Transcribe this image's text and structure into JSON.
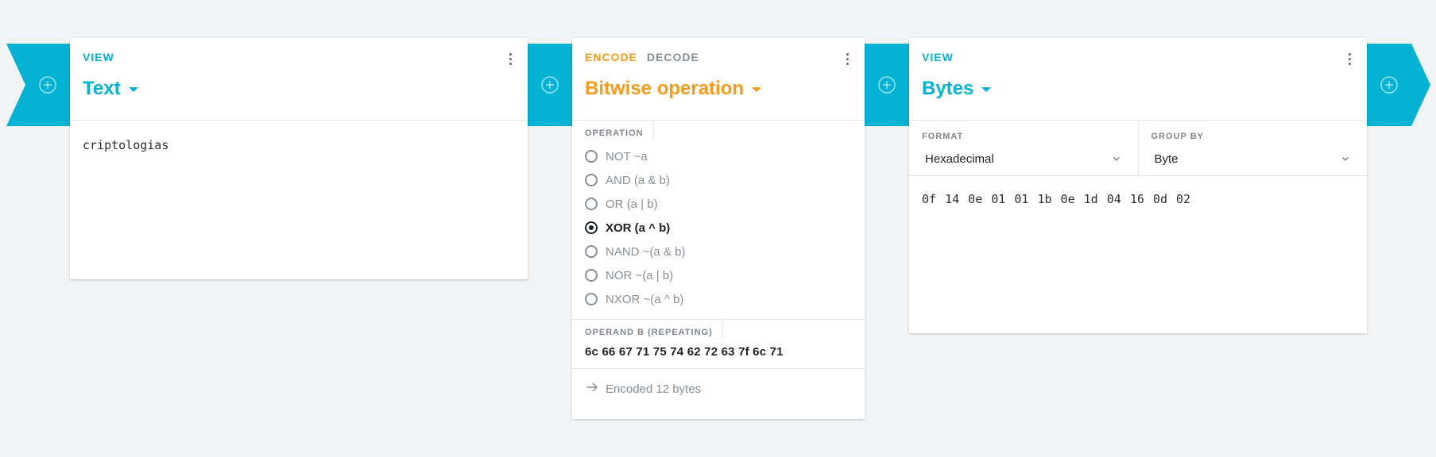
{
  "colors": {
    "accent_cyan": "#04b3d4",
    "accent_orange": "#f79b1a",
    "background": "#f2f3f5"
  },
  "connectors": [
    {
      "icon": "plus-circle-icon"
    },
    {
      "icon": "plus-circle-icon"
    },
    {
      "icon": "plus-circle-icon"
    },
    {
      "icon": "plus-circle-icon"
    }
  ],
  "text_card": {
    "tab_view": "VIEW",
    "title": "Text",
    "content": "criptologias"
  },
  "bitwise_card": {
    "tab_encode": "ENCODE",
    "tab_decode": "DECODE",
    "title": "Bitwise operation",
    "operation_label": "OPERATION",
    "operations": [
      {
        "label": "NOT ~a",
        "selected": false
      },
      {
        "label": "AND (a & b)",
        "selected": false
      },
      {
        "label": "OR (a | b)",
        "selected": false
      },
      {
        "label": "XOR (a ^ b)",
        "selected": true
      },
      {
        "label": "NAND ~(a & b)",
        "selected": false
      },
      {
        "label": "NOR ~(a | b)",
        "selected": false
      },
      {
        "label": "NXOR ~(a ^ b)",
        "selected": false
      }
    ],
    "operand_label": "OPERAND B (REPEATING)",
    "operand_value": "6c 66 67 71 75 74 62 72 63 7f 6c 71",
    "status": "Encoded 12 bytes"
  },
  "bytes_card": {
    "tab_view": "VIEW",
    "title": "Bytes",
    "format_label": "FORMAT",
    "format_value": "Hexadecimal",
    "group_label": "GROUP BY",
    "group_value": "Byte",
    "content": "0f 14 0e 01 01 1b 0e 1d 04 16 0d 02"
  }
}
